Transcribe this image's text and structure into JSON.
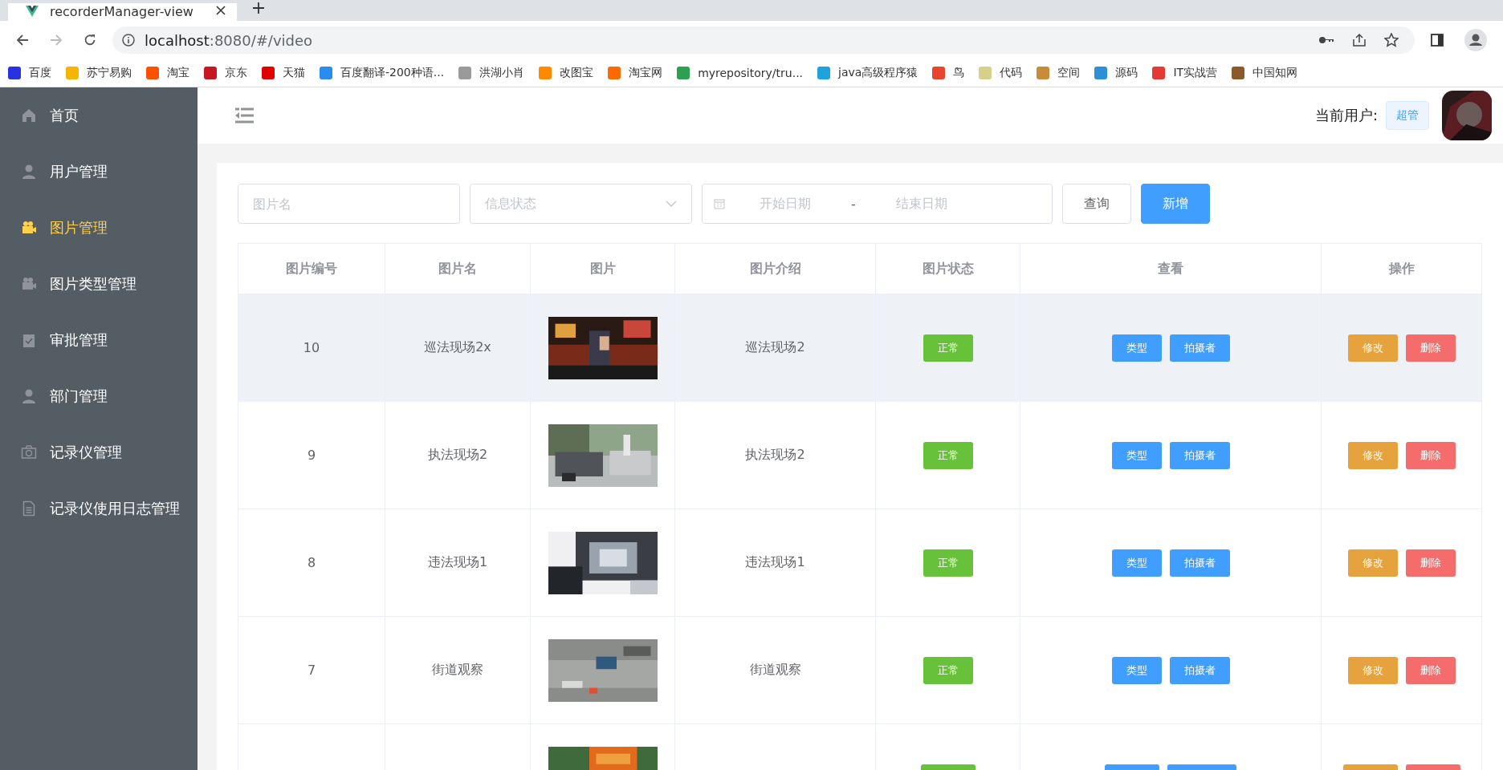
{
  "browser": {
    "tab_title": "recorderManager-view",
    "url_host": "localhost",
    "url_rest": ":8080/#/video",
    "bookmarks": [
      {
        "label": "百度",
        "color": "#2932e1"
      },
      {
        "label": "苏宁易购",
        "color": "#f5b500"
      },
      {
        "label": "淘宝",
        "color": "#ff5000"
      },
      {
        "label": "京东",
        "color": "#c91623"
      },
      {
        "label": "天猫",
        "color": "#e00000"
      },
      {
        "label": "百度翻译-200种语...",
        "color": "#2a8cf0"
      },
      {
        "label": "洪湖小肖",
        "color": "#9a9a9a"
      },
      {
        "label": "改图宝",
        "color": "#ff8a00"
      },
      {
        "label": "淘宝网",
        "color": "#ff6a00"
      },
      {
        "label": "myrepository/tru...",
        "color": "#2e9e4f"
      },
      {
        "label": "java高级程序猿",
        "color": "#1fa3dc"
      },
      {
        "label": "鸟",
        "color": "#e8452c"
      },
      {
        "label": "代码",
        "color": "#d6d08a"
      },
      {
        "label": "空间",
        "color": "#c98a3a"
      },
      {
        "label": "源码",
        "color": "#2d8fd5"
      },
      {
        "label": "IT实战营",
        "color": "#e53935"
      },
      {
        "label": "中国知网",
        "color": "#8b5a2b"
      }
    ]
  },
  "sidebar": {
    "items": [
      {
        "label": "首页",
        "selected": false
      },
      {
        "label": "用户管理",
        "selected": false
      },
      {
        "label": "图片管理",
        "selected": true
      },
      {
        "label": "图片类型管理",
        "selected": false
      },
      {
        "label": "审批管理",
        "selected": false
      },
      {
        "label": "部门管理",
        "selected": false
      },
      {
        "label": "记录仪管理",
        "selected": false
      },
      {
        "label": "记录仪使用日志管理",
        "selected": false
      }
    ]
  },
  "header": {
    "user_label": "当前用户:",
    "role_tag": "超管"
  },
  "filters": {
    "name_placeholder": "图片名",
    "status_placeholder": "信息状态",
    "start_placeholder": "开始日期",
    "range_separator": "-",
    "end_placeholder": "结束日期",
    "query_button": "查询",
    "add_button": "新增"
  },
  "table": {
    "columns": [
      "图片编号",
      "图片名",
      "图片",
      "图片介绍",
      "图片状态",
      "查看",
      "操作"
    ],
    "rows": [
      {
        "id": "10",
        "name": "巡法现场2x",
        "intro": "巡法现场2",
        "status": "正常",
        "highlighted": true,
        "view_buttons": [
          "类型",
          "拍摄者"
        ],
        "op_buttons": [
          "修改",
          "删除"
        ]
      },
      {
        "id": "9",
        "name": "执法现场2",
        "intro": "执法现场2",
        "status": "正常",
        "highlighted": false,
        "view_buttons": [
          "类型",
          "拍摄者"
        ],
        "op_buttons": [
          "修改",
          "删除"
        ]
      },
      {
        "id": "8",
        "name": "违法现场1",
        "intro": "违法现场1",
        "status": "正常",
        "highlighted": false,
        "view_buttons": [
          "类型",
          "拍摄者"
        ],
        "op_buttons": [
          "修改",
          "删除"
        ]
      },
      {
        "id": "7",
        "name": "街道观察",
        "intro": "街道观察",
        "status": "正常",
        "highlighted": false,
        "view_buttons": [
          "类型",
          "拍摄者"
        ],
        "op_buttons": [
          "修改",
          "删除"
        ]
      },
      {
        "highlighted": false
      }
    ]
  }
}
